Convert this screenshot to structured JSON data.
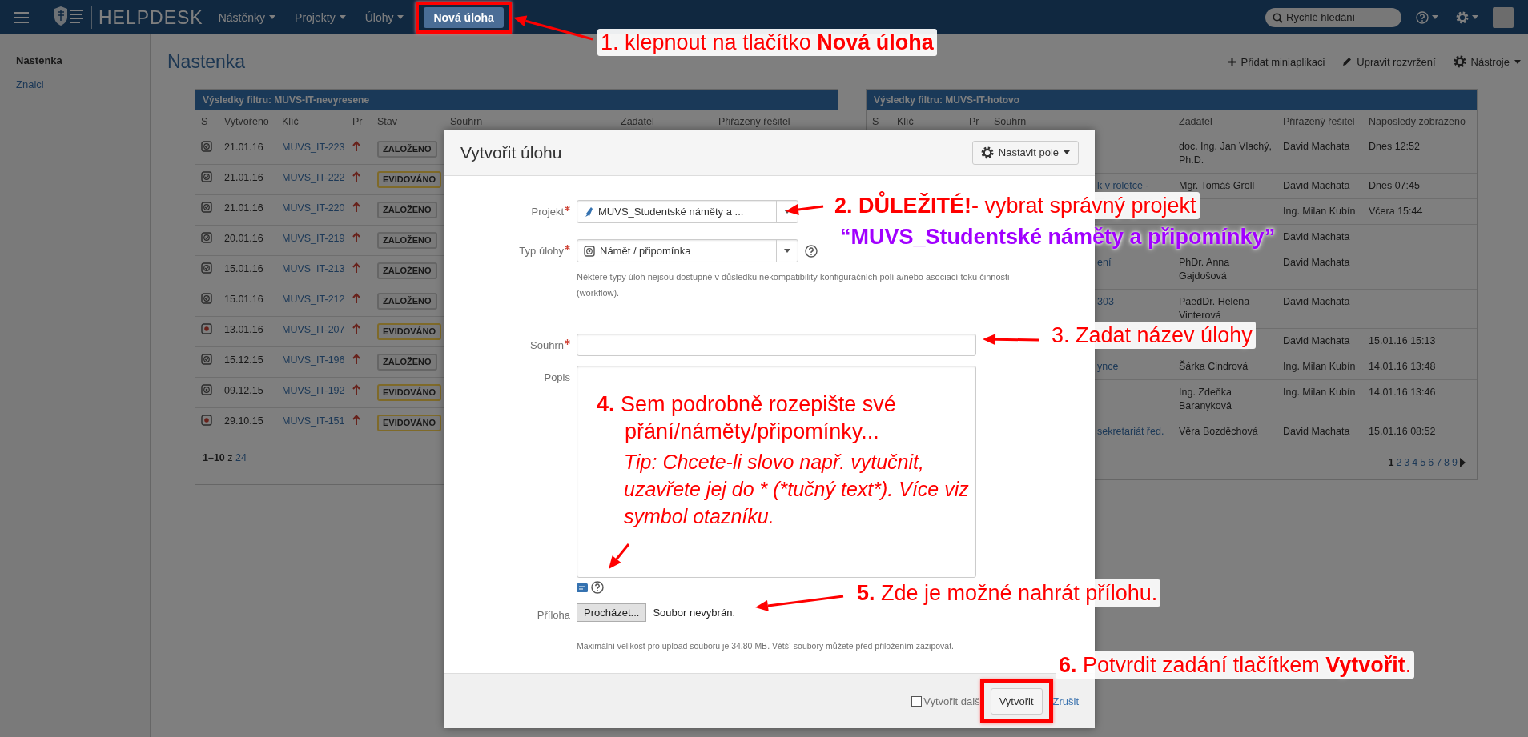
{
  "topbar": {
    "app_name": "HELPDESK",
    "nav": [
      {
        "label": "Nástěnky",
        "dropdown": true
      },
      {
        "label": "Projekty",
        "dropdown": true
      },
      {
        "label": "Úlohy",
        "dropdown": true
      }
    ],
    "create_button": {
      "label": "Nová úloha",
      "highlighted": true
    },
    "search": {
      "placeholder": "Rychlé hledání"
    }
  },
  "sidebar": {
    "items": [
      {
        "label": "Nastenka",
        "selected": true
      },
      {
        "label": "Znalci",
        "selected": false
      }
    ]
  },
  "dashboard": {
    "title": "Nastenka",
    "tools": [
      {
        "label": "Přidat miniaplikaci",
        "dropdown": false
      },
      {
        "label": "Upravit rozvržení",
        "dropdown": false
      },
      {
        "label": "Nástroje",
        "dropdown": true
      }
    ]
  },
  "gadgets": [
    {
      "title": "Výsledky filtru: MUVS-IT-nevyresene",
      "columns": [
        "S",
        "Vytvořeno",
        "Klíč",
        "Pr",
        "Stav",
        "Souhrn",
        "Zadatel",
        "Přiřazený řešitel"
      ],
      "rows": [
        {
          "kind": "task",
          "created": "21.01.16",
          "key": "MUVS_IT-223",
          "status": "ZALOŽENO",
          "color": "#666666"
        },
        {
          "kind": "task",
          "created": "21.01.16",
          "key": "MUVS_IT-222",
          "status": "EVIDOVÁNO",
          "color": "#806a29"
        },
        {
          "kind": "task",
          "created": "21.01.16",
          "key": "MUVS_IT-220",
          "status": "ZALOŽENO",
          "color": "#666666"
        },
        {
          "kind": "task",
          "created": "20.01.16",
          "key": "MUVS_IT-219",
          "status": "ZALOŽENO",
          "color": "#666666"
        },
        {
          "kind": "task",
          "created": "15.01.16",
          "key": "MUVS_IT-213",
          "status": "ZALOŽENO",
          "color": "#666666"
        },
        {
          "kind": "task",
          "created": "15.01.16",
          "key": "MUVS_IT-212",
          "status": "ZALOŽENO",
          "color": "#666666"
        },
        {
          "kind": "bug",
          "created": "13.01.16",
          "key": "MUVS_IT-207",
          "status": "EVIDOVÁNO",
          "color": "#806a29"
        },
        {
          "kind": "task",
          "created": "15.12.15",
          "key": "MUVS_IT-196",
          "status": "ZALOŽENO",
          "color": "#666666"
        },
        {
          "kind": "idea",
          "created": "09.12.15",
          "key": "MUVS_IT-192",
          "status": "EVIDOVÁNO",
          "color": "#806a29"
        },
        {
          "kind": "bug",
          "created": "29.10.15",
          "key": "MUVS_IT-151",
          "status": "EVIDOVÁNO",
          "color": "#806a29"
        }
      ],
      "pager": {
        "range": "1–10",
        "separator": "z",
        "total": "24"
      }
    },
    {
      "title": "Výsledky filtru: MUVS-IT-hotovo",
      "columns": [
        "S",
        "Klíč",
        "Pr",
        "Souhrn",
        "Zadatel",
        "Přiřazený řešitel",
        "Naposledy zobrazeno"
      ],
      "rows": [
        {
          "reporter": "doc. Ing. Jan Vlachý, Ph.D.",
          "assignee": "David Machata",
          "viewed": "Dnes 12:52"
        },
        {
          "summary": "k v roletce -",
          "reporter": "Mgr. Tomáš Groll",
          "assignee": "David Machata",
          "viewed": "Dnes 07:45"
        },
        {
          "assignee": "Ing. Milan Kubín",
          "viewed": "Včera 15:44"
        },
        {
          "assignee": "David Machata"
        },
        {
          "summary": "ení",
          "reporter": "PhDr. Anna Gajdošová",
          "assignee": "David Machata"
        },
        {
          "summary": "303",
          "reporter": "PaedDr. Helena Vinterová",
          "assignee": "David Machata"
        },
        {
          "assignee": "David Machata",
          "viewed": "15.01.16 15:13"
        },
        {
          "summary": "ynce",
          "reporter": "Šárka Cindrová",
          "assignee": "Ing. Milan Kubín",
          "viewed": "14.01.16 13:48"
        },
        {
          "reporter": "Ing. Zdeňka Baranyková",
          "assignee": "Ing. Milan Kubín",
          "viewed": "14.01.16 13:46"
        },
        {
          "summary": "sekretariát řed.",
          "reporter": "Věra Bozděchová",
          "assignee": "David Machata",
          "viewed": "15.01.16 08:52"
        }
      ],
      "pages": [
        {
          "label": "1",
          "selected": true
        },
        {
          "label": "2",
          "selected": false
        },
        {
          "label": "3",
          "selected": false
        },
        {
          "label": "4",
          "selected": false
        },
        {
          "label": "5",
          "selected": false
        },
        {
          "label": "6",
          "selected": false
        },
        {
          "label": "7",
          "selected": false
        },
        {
          "label": "8",
          "selected": false
        },
        {
          "label": "9",
          "selected": false
        }
      ]
    }
  ],
  "dialog": {
    "title": "Vytvořit úlohu",
    "configure_button": "Nastavit pole",
    "fields": [
      {
        "kind": "select",
        "label": "Projekt",
        "required": true,
        "value": "MUVS_Studentské náměty a ...",
        "help": false
      },
      {
        "kind": "select",
        "label": "Typ úlohy",
        "required": true,
        "value": "Námět / připomínka",
        "help": true,
        "hint": "Některé typy úloh nejsou dostupné v důsledku nekompatibility konfiguračních polí a/nebo asociací toku činnosti (workflow)."
      },
      {
        "kind": "divider"
      },
      {
        "kind": "text",
        "label": "Souhrn",
        "required": true
      },
      {
        "kind": "textarea",
        "label": "Popis",
        "required": false,
        "help": true
      },
      {
        "kind": "file",
        "label": "Příloha",
        "required": false,
        "button": "Procházet...",
        "status": "Soubor nevybrán.",
        "hint": "Maximální velikost pro upload souboru je 34.80 MB. Větší soubory můžete před přiložením zazipovat."
      }
    ],
    "footer": {
      "create_another": {
        "label": "Vytvořit dalš",
        "checked": false
      },
      "submit": {
        "label": "Vytvořit",
        "highlighted": true
      },
      "cancel": "Zrušit"
    }
  },
  "annotations": [
    {
      "kind": "step",
      "color": "#ff0000",
      "text": "1. klepnout na tlačítko **Nová úloha**"
    },
    {
      "kind": "step",
      "color": "#ff0000",
      "text": "**2. DŮLEŽITÉ!**- vybrat správný projekt"
    },
    {
      "kind": "emphasis",
      "color": "#a100ff",
      "text": "“MUVS_Studentské náměty a připomínky”"
    },
    {
      "kind": "step",
      "color": "#ff0000",
      "text": "3. Zadat název úlohy"
    },
    {
      "kind": "step",
      "color": "#ff0000",
      "text": "**4.** Sem podrobně rozepište své přání/náměty/připomínky..."
    },
    {
      "kind": "tip",
      "color": "#ff0000",
      "text": "Tip: Chcete-li slovo např. vytučnit, uzavřete jej do * (*tučný text*). Více viz symbol otazníku."
    },
    {
      "kind": "step",
      "color": "#ff0000",
      "text": "**5.** Zde je možné nahrát přílohu."
    },
    {
      "kind": "step",
      "color": "#ff0000",
      "text": "**6.** Potvrdit zadání tlačítkem **Vytvořit**."
    }
  ]
}
